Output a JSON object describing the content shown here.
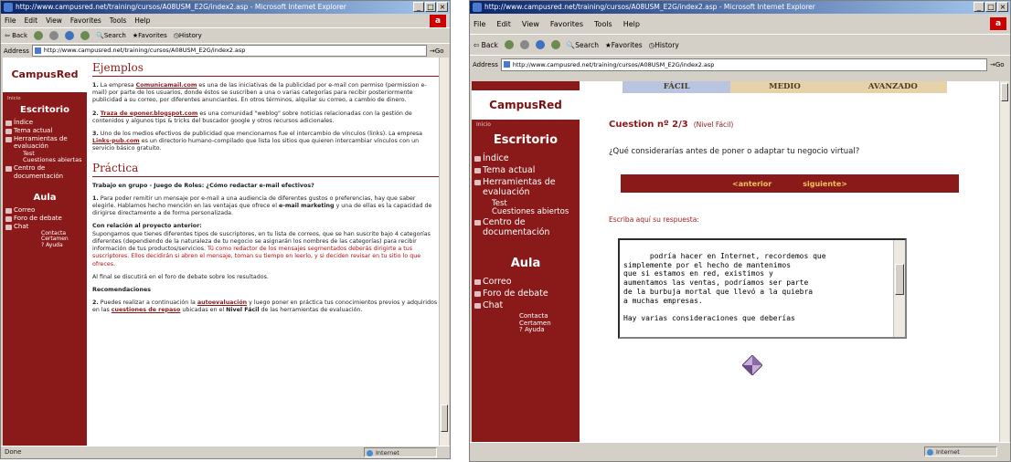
{
  "left_window": {
    "title": "http://www.campusred.net/training/cursos/A08USM_E2G/index2.asp - Microsoft Internet Explorer",
    "menu": [
      "File",
      "Edit",
      "View",
      "Favorites",
      "Tools",
      "Help"
    ],
    "toolbar": {
      "back": "Back",
      "search": "Search",
      "favorites": "Favorites",
      "history": "History"
    },
    "address_label": "Address",
    "address": "http://www.campusred.net/training/cursos/A08USM_E2G/index2.asp",
    "go": "Go",
    "status": "Done",
    "zone": "Internet",
    "sidebar": {
      "logo": "CampusRed",
      "small": "Inicio",
      "escritorio": "Escritorio",
      "items": [
        "Índice",
        "Tema actual",
        "Herramientas de evaluación"
      ],
      "subitems": [
        "Test",
        "Cuestiones abiertas"
      ],
      "centro": "Centro de documentación",
      "aula": "Aula",
      "aula_items": [
        "Correo",
        "Foro de debate",
        "Chat"
      ],
      "chat_sub": [
        "Contacta",
        "Certamen"
      ],
      "ayuda": "Ayuda"
    },
    "ejemplos_title": "Ejemplos",
    "ejemplo1_num": "1.",
    "ejemplo1_link": "Comunicamail.com",
    "ejemplo1_text": "es una de las iniciativas de la publicidad por e-mail con permiso (permission e-mail) por parte de los usuarios, donde éstos se suscriben a una o varias categorías para recibir posteriormente publicidad a su correo, por diferentes anunciantes. En otros términos, alquilar su correo, a cambio de dinero.",
    "ejemplo2_num": "2.",
    "ejemplo2_link": "Traza de eponer.blogspot.com",
    "ejemplo2_text": "es una comunidad \"weblog\" sobre noticias relacionadas con la gestión de contenidos y algunos tips & tricks del buscador google y otros recursos adicionales.",
    "ejemplo3_num": "3.",
    "ejemplo3_text_a": "Uno de los medios efectivos de publicidad que mencionamos fue el intercambio de vínculos (links). La empresa",
    "ejemplo3_link": "Links-pub.com",
    "ejemplo3_text_b": "es un directorio humano-compilado que lista los sitios que quieren intercambiar vínculos con un servicio básico gratuito.",
    "practica_title": "Práctica",
    "trabajo_title": "Trabajo en grupo - Juego de Roles: ¿Cómo redactar e-mail efectivos?",
    "p1_num": "1.",
    "p1_text_a": "Para poder remitir un mensaje por e-mail a una audiencia de diferentes gustos o preferencias, hay que saber elegirle. Hablamos hecho mención en las ventajas que ofrece el",
    "p1_bold": "e-mail marketing",
    "p1_text_b": "y una de ellas es la capacidad de dirigirse directamente a de forma personalizada.",
    "relacion_title": "Con relación al proyecto anterior:",
    "relacion_text": "Supongamos que tienes diferentes tipos de suscriptores, en tu lista de correos, que se han suscrito bajo 4 categorías diferentes (dependiendo de la naturaleza de tu negocio se asignarán los nombres de las categorías) para recibir información de tus productos/servicios.",
    "relacion_red": "Tú como redactor de los mensajes segmentados deberás dirigirte a tus suscriptores. Ellos decidirán si abren el mensaje, toman su tiempo en leerlo, y si deciden revisar en tu sitio lo que ofreces.",
    "final_text": "Al final se discutirá en el foro de debate sobre los resultados.",
    "recom_title": "Recomendaciones",
    "p2_num": "2.",
    "p2_text_a": "Puedes realizar a continuación la",
    "p2_link1": "autoevaluación",
    "p2_text_b": "y luego poner en práctica tus conocimientos previos y adquiridos en las",
    "p2_link2": "cuestiones de repaso",
    "p2_text_c": "ubicadas en el",
    "p2_bold": "Nivel Fácil",
    "p2_text_d": "de las herramientas de evaluación."
  },
  "right_window": {
    "title": "http://www.campusred.net/training/cursos/A08USM_E2G/index2.asp - Microsoft Internet Explorer",
    "menu": [
      "File",
      "Edit",
      "View",
      "Favorites",
      "Tools",
      "Help"
    ],
    "toolbar": {
      "back": "Back",
      "search": "Search",
      "favorites": "Favorites",
      "history": "History"
    },
    "address_label": "Address",
    "address": "http://www.campusred.net/training/cursos/A08USM_E2G/index2.asp",
    "go": "Go",
    "status": "",
    "zone": "Internet",
    "sidebar": {
      "logo": "CampusRed",
      "small": "Inicio",
      "escritorio": "Escritorio",
      "items": [
        "Índice",
        "Tema actual",
        "Herramientas de evaluación"
      ],
      "subitems": [
        "Test",
        "Cuestiones abiertos"
      ],
      "centro": "Centro de documentación",
      "aula": "Aula",
      "aula_items": [
        "Correo",
        "Foro de debate",
        "Chat"
      ],
      "chat_sub": [
        "Contacta",
        "Certamen"
      ],
      "ayuda": "Ayuda"
    },
    "tabs": [
      "FÁCIL",
      "MEDIO",
      "AVANZADO"
    ],
    "question_title": "Cuestion nº 2/3",
    "question_level": "(Nivel Fácil)",
    "question_text": "¿Qué considerarías antes de poner o adaptar tu negocio virtual?",
    "nav_prev": "<anterior",
    "nav_next": "siguiente>",
    "answer_label": "Escriba aquí su respuesta:",
    "answer_text": "podría hacer en Internet, recordemos que\nsimplemente por el hecho de mantenimos\nque si estamos en red, existimos y\naumentamos las ventas, podríamos ser parte\nde la burbuja mortal que llevó a la quiebra\na muchas empresas.\n\nHay varias consideraciones que deberías"
  }
}
